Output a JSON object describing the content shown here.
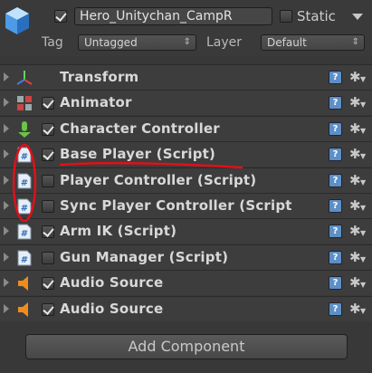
{
  "header": {
    "active_checked": true,
    "object_name": "Hero_Unitychan_CampR",
    "static_label": "Static",
    "static_checked": false,
    "tag_label": "Tag",
    "tag_value": "Untagged",
    "layer_label": "Layer",
    "layer_value": "Default"
  },
  "components": [
    {
      "title": "Transform",
      "icon": "transform-axes-icon",
      "has_checkbox": false,
      "checked": false
    },
    {
      "title": "Animator",
      "icon": "animator-icon",
      "has_checkbox": true,
      "checked": true
    },
    {
      "title": "Character Controller",
      "icon": "character-controller-icon",
      "has_checkbox": true,
      "checked": true
    },
    {
      "title": "Base Player (Script)",
      "icon": "script-icon",
      "has_checkbox": true,
      "checked": true
    },
    {
      "title": "Player Controller (Script)",
      "icon": "script-icon",
      "has_checkbox": true,
      "checked": false
    },
    {
      "title": "Sync Player Controller (Script",
      "icon": "script-icon",
      "has_checkbox": true,
      "checked": false
    },
    {
      "title": "Arm IK (Script)",
      "icon": "script-icon",
      "has_checkbox": true,
      "checked": true
    },
    {
      "title": "Gun Manager (Script)",
      "icon": "script-icon",
      "has_checkbox": true,
      "checked": false
    },
    {
      "title": "Audio Source",
      "icon": "speaker-icon",
      "has_checkbox": true,
      "checked": true
    },
    {
      "title": "Audio Source",
      "icon": "speaker-icon",
      "has_checkbox": true,
      "checked": true
    }
  ],
  "add_component_label": "Add Component",
  "colors": {
    "annotation_red": "#e0101a",
    "help_blue": "#5d8fc7",
    "panel_bg": "#383838"
  }
}
